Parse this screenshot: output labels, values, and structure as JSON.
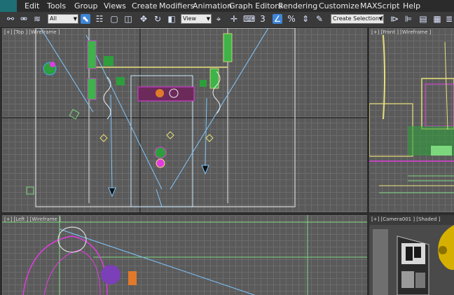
{
  "menu": {
    "items": [
      "Edit",
      "Tools",
      "Group",
      "Views",
      "Create",
      "Modifiers",
      "Animation",
      "Graph Editors",
      "Rendering",
      "Customize",
      "MAXScript",
      "Help"
    ]
  },
  "toolbar": {
    "filter_value": "All",
    "refcoord_value": "View",
    "selection_set_value": "Create Selection S",
    "icons": [
      "link-icon",
      "unlink-icon",
      "bind-spacewarp-icon",
      "select-icon",
      "select-by-name-icon",
      "rect-region-icon",
      "window-crossing-icon",
      "select-move-icon",
      "select-rotate-icon",
      "select-scale-icon",
      "pivot-icon",
      "keyboard-shortcut-icon",
      "snap-3d-icon",
      "angle-snap-icon",
      "percent-snap-icon",
      "spinner-snap-icon",
      "edit-named-sel-icon",
      "mirror-icon",
      "align-icon",
      "layer-icon"
    ]
  },
  "viewports": {
    "top": {
      "label": "[+] [Top ] [Wireframe ]"
    },
    "front": {
      "label": "[+] [Front ] [Wireframe ]"
    },
    "left": {
      "label": "[+] [Left ] [Wireframe ]"
    },
    "camera": {
      "label": "[+] [Camera001 ] [Shaded ]"
    }
  },
  "colors": {
    "accent": "#3f86d8",
    "wire_green": "#7dd87d",
    "wire_magenta": "#e23ce0",
    "wire_yellow": "#e8e07a",
    "wire_blue": "#7fc7ff"
  }
}
